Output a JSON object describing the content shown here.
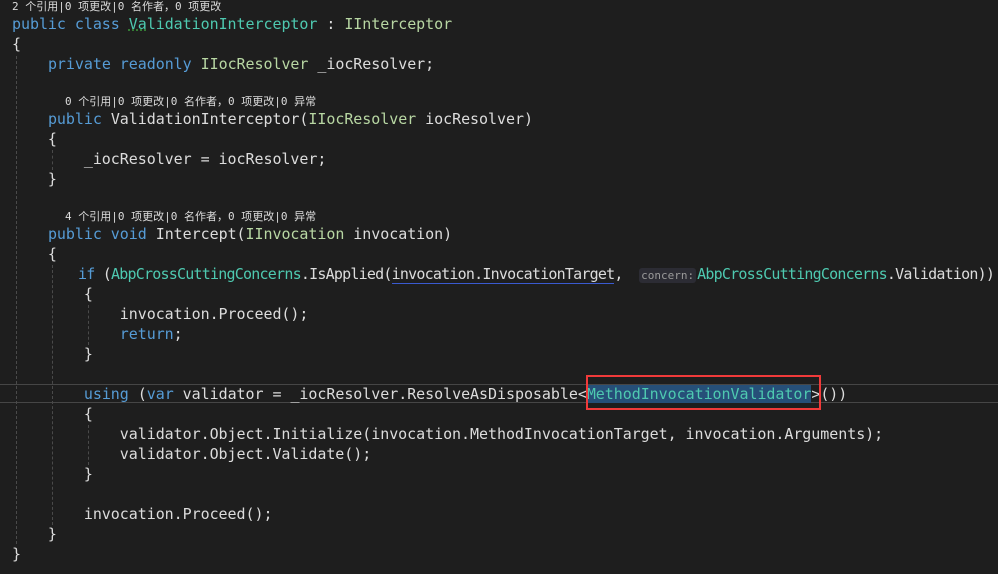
{
  "colors": {
    "background": "#1e1e1e",
    "keyword": "#569cd6",
    "type": "#4ec9b0",
    "interface": "#b8d7a3",
    "text": "#dcdcdc",
    "codelens": "#999999",
    "highlight_box": "#f03a3a",
    "selection": "#264f78"
  },
  "lines": [
    {
      "kind": "lens",
      "tokens": [
        [
          "2 个引用|0 项更改|0 名作者，0 项更改",
          "tx"
        ]
      ]
    },
    {
      "kind": "code",
      "tokens": [
        [
          "public class ",
          "kw"
        ],
        [
          "Va",
          "ty squig"
        ],
        [
          "lidationInterceptor",
          "ty"
        ],
        [
          " : ",
          "tx"
        ],
        [
          "IInterceptor",
          "if"
        ]
      ]
    },
    {
      "kind": "code",
      "tokens": [
        [
          "{",
          "tx"
        ]
      ]
    },
    {
      "kind": "code",
      "tokens": [
        [
          "    ",
          "tx"
        ],
        [
          "private readonly ",
          "kw"
        ],
        [
          "IIocResolver",
          "if"
        ],
        [
          " _iocResolver;",
          "tx"
        ]
      ]
    },
    {
      "kind": "code",
      "tokens": []
    },
    {
      "kind": "lens",
      "tokens": [
        [
          "        0 个引用|0 项更改|0 名作者，0 项更改|0 异常",
          "tx"
        ]
      ]
    },
    {
      "kind": "code",
      "tokens": [
        [
          "    ",
          "tx"
        ],
        [
          "public ",
          "kw"
        ],
        [
          "ValidationInterceptor(",
          "tx"
        ],
        [
          "IIocResolver",
          "if"
        ],
        [
          " iocResolver)",
          "tx"
        ]
      ]
    },
    {
      "kind": "code",
      "tokens": [
        [
          "    {",
          "tx"
        ]
      ]
    },
    {
      "kind": "code",
      "tokens": [
        [
          "        _iocResolver = iocResolver;",
          "tx"
        ]
      ]
    },
    {
      "kind": "code",
      "tokens": [
        [
          "    }",
          "tx"
        ]
      ]
    },
    {
      "kind": "code",
      "tokens": []
    },
    {
      "kind": "lens",
      "tokens": [
        [
          "        4 个引用|0 项更改|0 名作者，0 项更改|0 异常",
          "tx"
        ]
      ]
    },
    {
      "kind": "code",
      "tokens": [
        [
          "    ",
          "tx"
        ],
        [
          "public void ",
          "kw"
        ],
        [
          "Intercept(",
          "tx"
        ],
        [
          "IInvocation",
          "if"
        ],
        [
          " invocation)",
          "tx"
        ]
      ]
    },
    {
      "kind": "code",
      "tokens": [
        [
          "    {",
          "tx"
        ]
      ]
    },
    {
      "kind": "code",
      "tokens": [
        [
          "        ",
          "tx"
        ],
        [
          "if",
          "kw"
        ],
        [
          " (",
          "tx"
        ],
        [
          "AbpCrossCuttingConcerns",
          "ty"
        ],
        [
          ".IsApplied(",
          "tx"
        ],
        [
          "invocation.InvocationTarget",
          "tx ul"
        ],
        [
          ",  ",
          "tx"
        ],
        [
          "concern:",
          "hint"
        ],
        [
          "AbpCrossCuttingConcerns",
          "ty"
        ],
        [
          ".Validation))",
          "tx"
        ]
      ]
    },
    {
      "kind": "code",
      "tokens": [
        [
          "        {",
          "tx"
        ]
      ]
    },
    {
      "kind": "code",
      "tokens": [
        [
          "            invocation.Proceed();",
          "tx"
        ]
      ]
    },
    {
      "kind": "code",
      "tokens": [
        [
          "            ",
          "tx"
        ],
        [
          "return",
          "kw"
        ],
        [
          ";",
          "tx"
        ]
      ]
    },
    {
      "kind": "code",
      "tokens": [
        [
          "        }",
          "tx"
        ]
      ]
    },
    {
      "kind": "code",
      "tokens": []
    },
    {
      "kind": "code",
      "tokens": [
        [
          "        ",
          "tx"
        ],
        [
          "using",
          "kw"
        ],
        [
          " (",
          "tx"
        ],
        [
          "var",
          "kw"
        ],
        [
          " validator = _iocResolver.ResolveAsDisposable<",
          "tx"
        ],
        [
          "MethodInvocationValidator",
          "ty sel"
        ],
        [
          ">())",
          "tx"
        ]
      ]
    },
    {
      "kind": "code",
      "tokens": [
        [
          "        {",
          "tx"
        ]
      ]
    },
    {
      "kind": "code",
      "tokens": [
        [
          "            validator.Object.Initialize(invocation.MethodInvocationTarget, invocation.Arguments);",
          "tx"
        ]
      ]
    },
    {
      "kind": "code",
      "tokens": [
        [
          "            validator.Object.Validate();",
          "tx"
        ]
      ]
    },
    {
      "kind": "code",
      "tokens": [
        [
          "        }",
          "tx"
        ]
      ]
    },
    {
      "kind": "code",
      "tokens": []
    },
    {
      "kind": "code",
      "tokens": [
        [
          "        invocation.Proceed();",
          "tx"
        ]
      ]
    },
    {
      "kind": "code",
      "tokens": [
        [
          "    }",
          "tx"
        ]
      ]
    },
    {
      "kind": "code",
      "tokens": [
        [
          "}",
          "tx"
        ]
      ]
    }
  ]
}
